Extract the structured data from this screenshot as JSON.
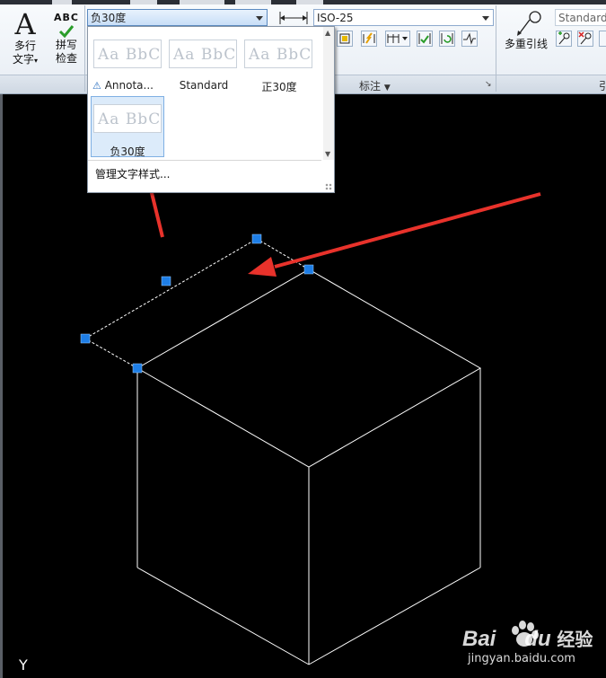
{
  "ribbon": {
    "multiline_text": {
      "label_line1": "多行",
      "label_line2": "文字"
    },
    "spell_check": {
      "icon_text": "ABC",
      "label_line1": "拼写",
      "label_line2": "检查"
    },
    "text_style_combo": {
      "value": "负30度"
    },
    "dim_style_combo": {
      "value": "ISO-25"
    },
    "dimension_panel_title": "标注",
    "multileader": {
      "label": "多重引线"
    },
    "leader_style_combo": {
      "value": "Standard"
    },
    "leader_panel_title": "引"
  },
  "dropdown": {
    "thumbnail_text": "Aa BbCc",
    "styles": [
      {
        "label": "Annota...",
        "annotative": true
      },
      {
        "label": "Standard",
        "annotative": false
      },
      {
        "label": "正30度",
        "annotative": false
      },
      {
        "label": "负30度",
        "annotative": false,
        "selected": true
      }
    ],
    "manage_label": "管理文字样式..."
  },
  "canvas": {
    "axis_label": "Y"
  },
  "watermark": {
    "brand": "Bai",
    "brand2": "du",
    "product": "经验",
    "url": "jingyan.baidu.com"
  },
  "colors": {
    "grip": "#1e7ee6",
    "annotation_arrow": "#e8322b",
    "geometry": "#ffffff",
    "selection_highlight": "#dcebfa"
  }
}
